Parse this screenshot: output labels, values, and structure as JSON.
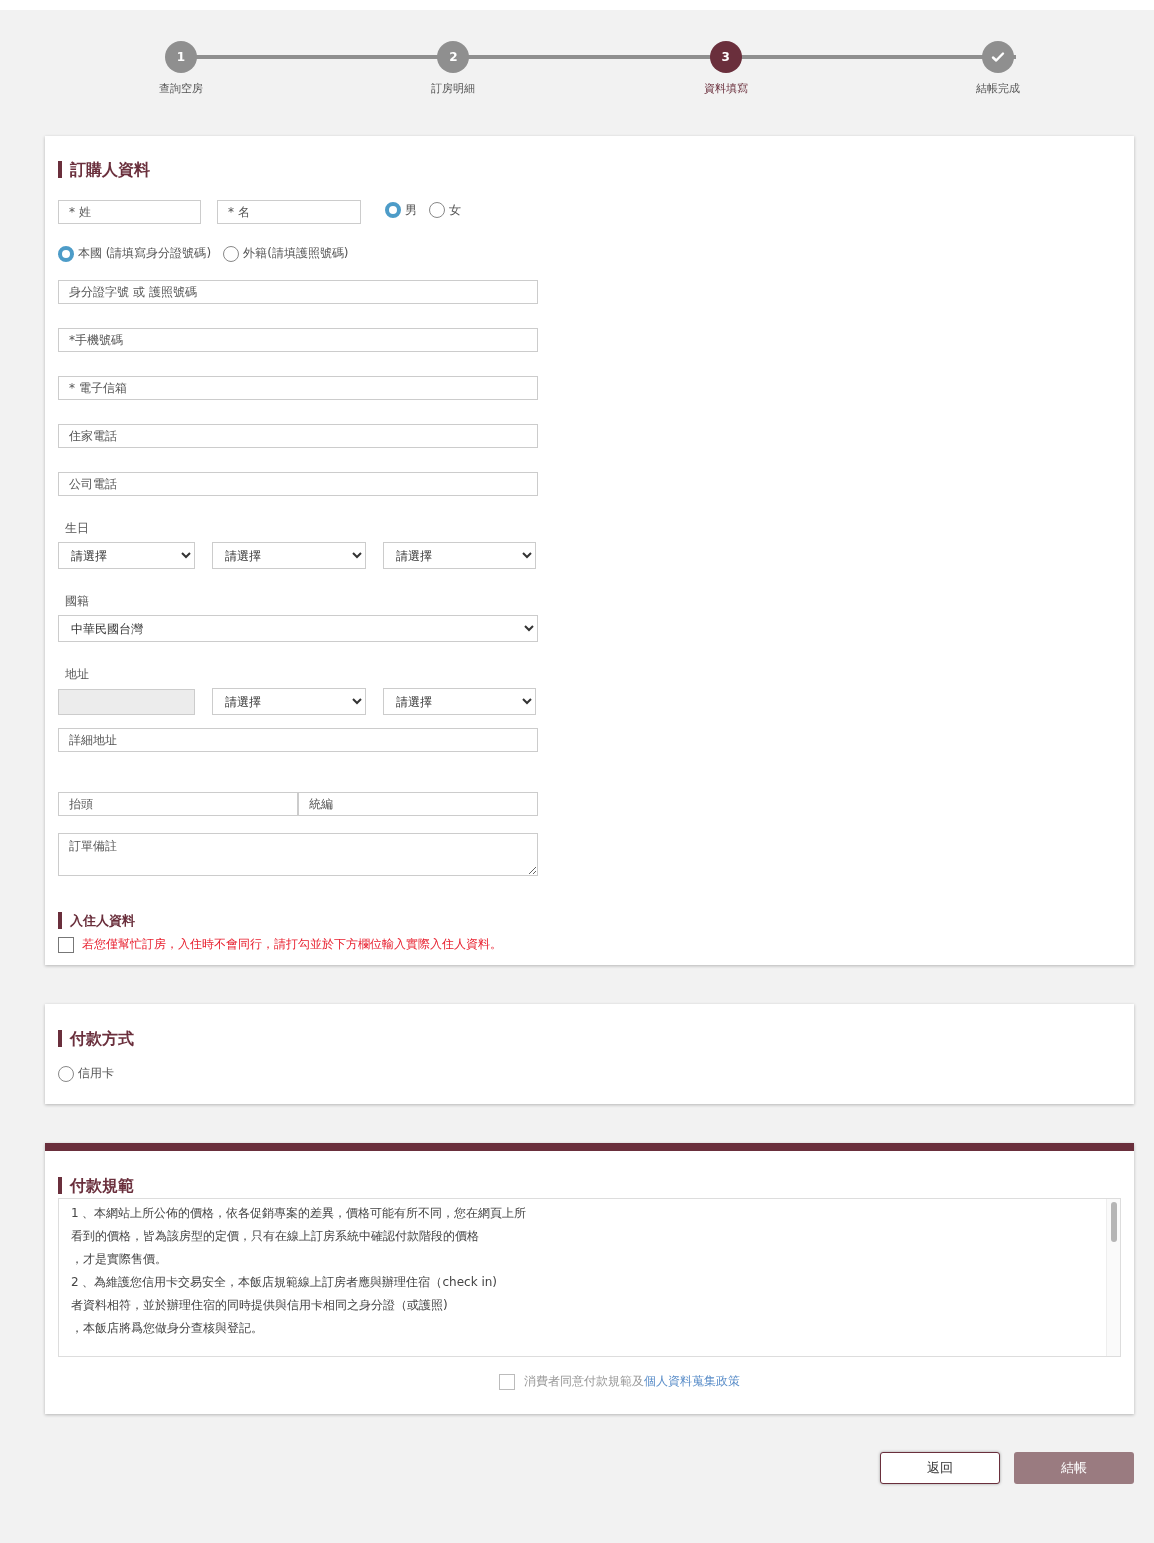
{
  "steps": [
    {
      "kind": "number",
      "number": "1",
      "label": "查詢空房",
      "selected": false
    },
    {
      "kind": "number",
      "number": "2",
      "label": "訂房明細",
      "selected": false
    },
    {
      "kind": "number",
      "number": "3",
      "label": "資料填寫",
      "selected": true
    },
    {
      "kind": "check",
      "label": "結帳完成",
      "selected": false
    }
  ],
  "booker": {
    "title": "訂購人資料",
    "last_name": {
      "placeholder": "* 姓"
    },
    "first_name": {
      "placeholder": "* 名"
    },
    "gender": [
      {
        "label": "男",
        "selected": true
      },
      {
        "label": "女",
        "selected": false
      }
    ],
    "nationality_type": [
      {
        "label": "本國 (請填寫身分證號碼)",
        "selected": true
      },
      {
        "label": "外籍(請填護照號碼)",
        "selected": false
      }
    ],
    "contact_fields": [
      {
        "placeholder": "身分證字號 或 護照號碼"
      },
      {
        "placeholder": "*手機號碼"
      },
      {
        "placeholder": "* 電子信箱"
      },
      {
        "placeholder": "住家電話"
      },
      {
        "placeholder": "公司電話"
      }
    ],
    "birthday": {
      "label": "生日",
      "selects": [
        "請選擇",
        "請選擇",
        "請選擇"
      ]
    },
    "country": {
      "label": "國籍",
      "value": "中華民國台灣"
    },
    "address": {
      "label": "地址",
      "selects": [
        "請選擇",
        "請選擇"
      ],
      "detail": {
        "placeholder": "詳細地址"
      }
    },
    "invoice": [
      {
        "placeholder": "抬頭"
      },
      {
        "placeholder": "統編"
      }
    ],
    "notes": {
      "placeholder": "訂單備註"
    },
    "guest": {
      "title": "入住人資料",
      "checked": false,
      "text": "若您僅幫忙訂房，入住時不會同行，請打勾並於下方欄位輸入實際入住人資料。"
    }
  },
  "payment": {
    "title": "付款方式",
    "options": [
      {
        "label": "信用卡",
        "selected": false
      }
    ]
  },
  "rules": {
    "title": "付款規範",
    "lines": [
      "1 、本網站上所公佈的價格，依各促銷專案的差異，價格可能有所不同，您在網頁上所",
      "看到的價格，皆為該房型的定價，只有在線上訂房系統中確認付款階段的價格",
      "，才是實際售價。",
      "2 、為維護您信用卡交易安全，本飯店規範線上訂房者應與辦理住宿（check in)",
      "者資料相符，並於辦理住宿的同時提供與信用卡相同之身分證（或護照)",
      "，本飯店將爲您做身分查核與登記。"
    ],
    "consent": {
      "checked": false,
      "text": "消費者同意付款規範及",
      "link": "個人資料蒐集政策"
    }
  },
  "buttons": [
    {
      "kind": "secondary",
      "label": "返回"
    },
    {
      "kind": "primary",
      "label": "結帳"
    }
  ]
}
